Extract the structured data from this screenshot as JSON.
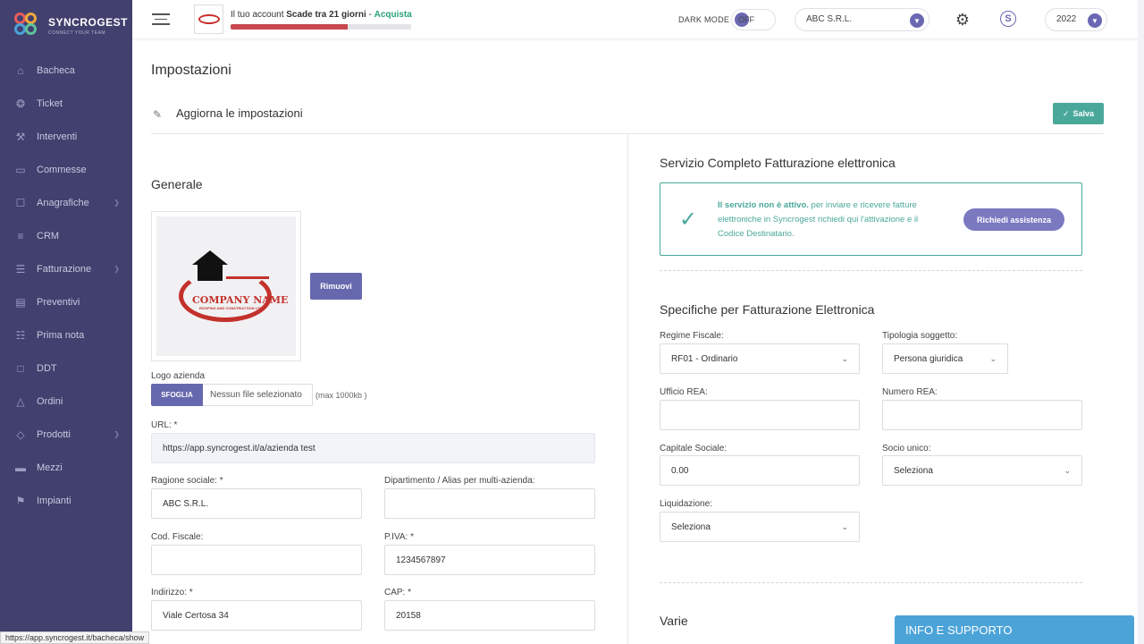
{
  "brand": {
    "name": "SYNCROGEST",
    "tagline": "CONNECT YOUR TEAM"
  },
  "sidebar": {
    "items": [
      {
        "label": "Bacheca",
        "icon": "home-icon",
        "arrow": false
      },
      {
        "label": "Ticket",
        "icon": "tag-icon",
        "arrow": false
      },
      {
        "label": "Interventi",
        "icon": "tools-icon",
        "arrow": false
      },
      {
        "label": "Commesse",
        "icon": "folder-icon",
        "arrow": false
      },
      {
        "label": "Anagrafiche",
        "icon": "inbox-icon",
        "arrow": true
      },
      {
        "label": "CRM",
        "icon": "stack-icon",
        "arrow": false
      },
      {
        "label": "Fatturazione",
        "icon": "invoice-icon",
        "arrow": true
      },
      {
        "label": "Preventivi",
        "icon": "document-icon",
        "arrow": false
      },
      {
        "label": "Prima nota",
        "icon": "note-icon",
        "arrow": false
      },
      {
        "label": "DDT",
        "icon": "file-icon",
        "arrow": false
      },
      {
        "label": "Ordini",
        "icon": "cart-icon",
        "arrow": false
      },
      {
        "label": "Prodotti",
        "icon": "box-icon",
        "arrow": true
      },
      {
        "label": "Mezzi",
        "icon": "truck-icon",
        "arrow": false
      },
      {
        "label": "Impianti",
        "icon": "flag-icon",
        "arrow": false
      }
    ]
  },
  "topbar": {
    "account_prefix": "Il tuo account",
    "account_expiry": "Scade tra 21 giorni",
    "account_sep": " - ",
    "account_buy": "Acquista",
    "trial_progress": 0.65,
    "dark_mode_label": "DARK MODE",
    "dark_mode_state": "OFF",
    "company": "ABC S.R.L.",
    "year": "2022",
    "coin_symbol": "S"
  },
  "page": {
    "title": "Impostazioni",
    "section_title": "Aggiorna le impostazioni",
    "save_label": "Salva"
  },
  "general": {
    "title": "Generale",
    "logo_company": "COMPANY NAME",
    "logo_sub": "ROOFING AND CONSTRUCTION LTD",
    "remove_label": "Rimuovi",
    "logo_label": "Logo azienda",
    "browse_label": "SFOGLIA",
    "no_file": "Nessun file selezionato",
    "file_note": "(max 1000kb )",
    "url_label": "URL: *",
    "url_value": "https://app.syncrogest.it/a/azienda test",
    "ragione_label": "Ragione sociale: *",
    "ragione_value": "ABC S.R.L.",
    "dipartimento_label": "Dipartimento / Alias per multi-azienda:",
    "dipartimento_value": "",
    "codfiscale_label": "Cod. Fiscale:",
    "codfiscale_value": "",
    "piva_label": "P.IVA: *",
    "piva_value": "1234567897",
    "indirizzo_label": "Indirizzo: *",
    "indirizzo_value": "Viale Certosa 34",
    "cap_label": "CAP: *",
    "cap_value": "20158"
  },
  "einvoice": {
    "title": "Servizio Completo Fatturazione elettronica",
    "notice_bold": "Il servizio non è attivo.",
    "notice_text": " per inviare e ricevere fatture elettroniche in Syncrogest richiedi qui l'attivazione e il Codice Destinatario.",
    "help_label": "Richiedi assistenza"
  },
  "specs": {
    "title": "Specifiche per Fatturazione Elettronica",
    "regime_label": "Regime Fiscale:",
    "regime_value": "RF01 - Ordinario",
    "tipologia_label": "Tipologia soggetto:",
    "tipologia_value": "Persona giuridica",
    "ufficio_label": "Ufficio REA:",
    "ufficio_value": "",
    "numero_label": "Numero REA:",
    "numero_value": "",
    "capitale_label": "Capitale Sociale:",
    "capitale_value": "0.00",
    "socio_label": "Socio unico:",
    "socio_value": "Seleziona",
    "liquidazione_label": "Liquidazione:",
    "liquidazione_value": "Seleziona"
  },
  "varie": {
    "title": "Varie"
  },
  "support": {
    "label": "INFO E SUPPORTO"
  },
  "status_url": "https://app.syncrogest.it/bacheca/show",
  "colors": {
    "sidebar": "#42406e",
    "accent": "#6668ae",
    "success": "#4aa89a",
    "danger": "#c8484f",
    "support": "#4ba3d8"
  }
}
